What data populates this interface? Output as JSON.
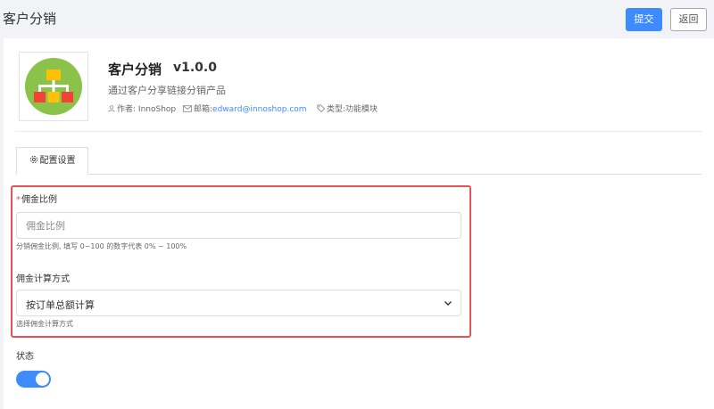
{
  "header": {
    "title": "客户分销",
    "submit_label": "提交",
    "back_label": "返回"
  },
  "plugin": {
    "name": "客户分销",
    "version": "v1.0.0",
    "description": "通过客户分享链接分销产品",
    "author_label": "作者:",
    "author": "InnoShop",
    "email_label": "邮箱:",
    "email": "edward@innoshop.com",
    "type_label": "类型:",
    "type": "功能模块"
  },
  "tabs": [
    {
      "label": "配置设置",
      "active": true
    }
  ],
  "form": {
    "commission_rate": {
      "label": "佣金比例",
      "required_mark": "*",
      "value": "",
      "placeholder": "佣金比例",
      "help": "分销佣金比例, 填写 0~100 的数字代表 0% ~ 100%"
    },
    "calc_method": {
      "label": "佣金计算方式",
      "selected": "按订单总额计算",
      "help": "选择佣金计算方式"
    },
    "status": {
      "label": "状态",
      "enabled": true
    }
  },
  "colors": {
    "primary": "#3d8bfd",
    "highlight_border": "#e55353",
    "logo_bg": "#8bc34a",
    "logo_top": "#ffc107",
    "logo_left": "#f44336",
    "logo_mid": "#ffc107",
    "logo_right": "#f44336"
  },
  "icons": {
    "author": "user-icon",
    "email": "mail-icon",
    "type": "tag-icon",
    "tab": "gear-icon",
    "select": "chevron-down-icon",
    "logo": "org-chart-icon"
  }
}
